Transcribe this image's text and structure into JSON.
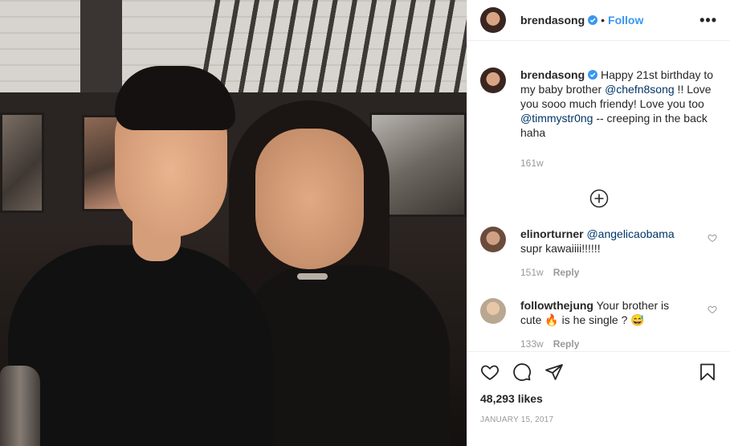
{
  "post": {
    "author": {
      "username": "brendasong",
      "verified": true
    },
    "follow_label": "Follow",
    "dot_separator": "•",
    "more_icon": "more-options-icon",
    "more_label": "•••",
    "caption": {
      "username": "brendasong",
      "text_1": " Happy 21st birthday to my baby brother ",
      "mention_1": "@chefn8song",
      "text_2": " !! Love you sooo much friendy! Love you too ",
      "mention_2": "@timmystr0ng",
      "text_3": " -- creeping in the back haha",
      "age": "161w"
    },
    "load_more_icon": "plus-circle-icon",
    "comments": [
      {
        "username": "elinorturner",
        "mention": "@angelicaobama",
        "text": "supr kawaiiii!!!!!!",
        "age": "151w",
        "reply_label": "Reply"
      },
      {
        "username": "followthejung",
        "text": " Your brother is cute 🔥 is he single ? 😅",
        "age": "133w",
        "reply_label": "Reply"
      }
    ],
    "likes": "48,293 likes",
    "date": "JANUARY 15, 2017"
  },
  "colors": {
    "link": "#3897f0",
    "mention": "#003569",
    "muted": "#999999",
    "border": "#efefef"
  }
}
